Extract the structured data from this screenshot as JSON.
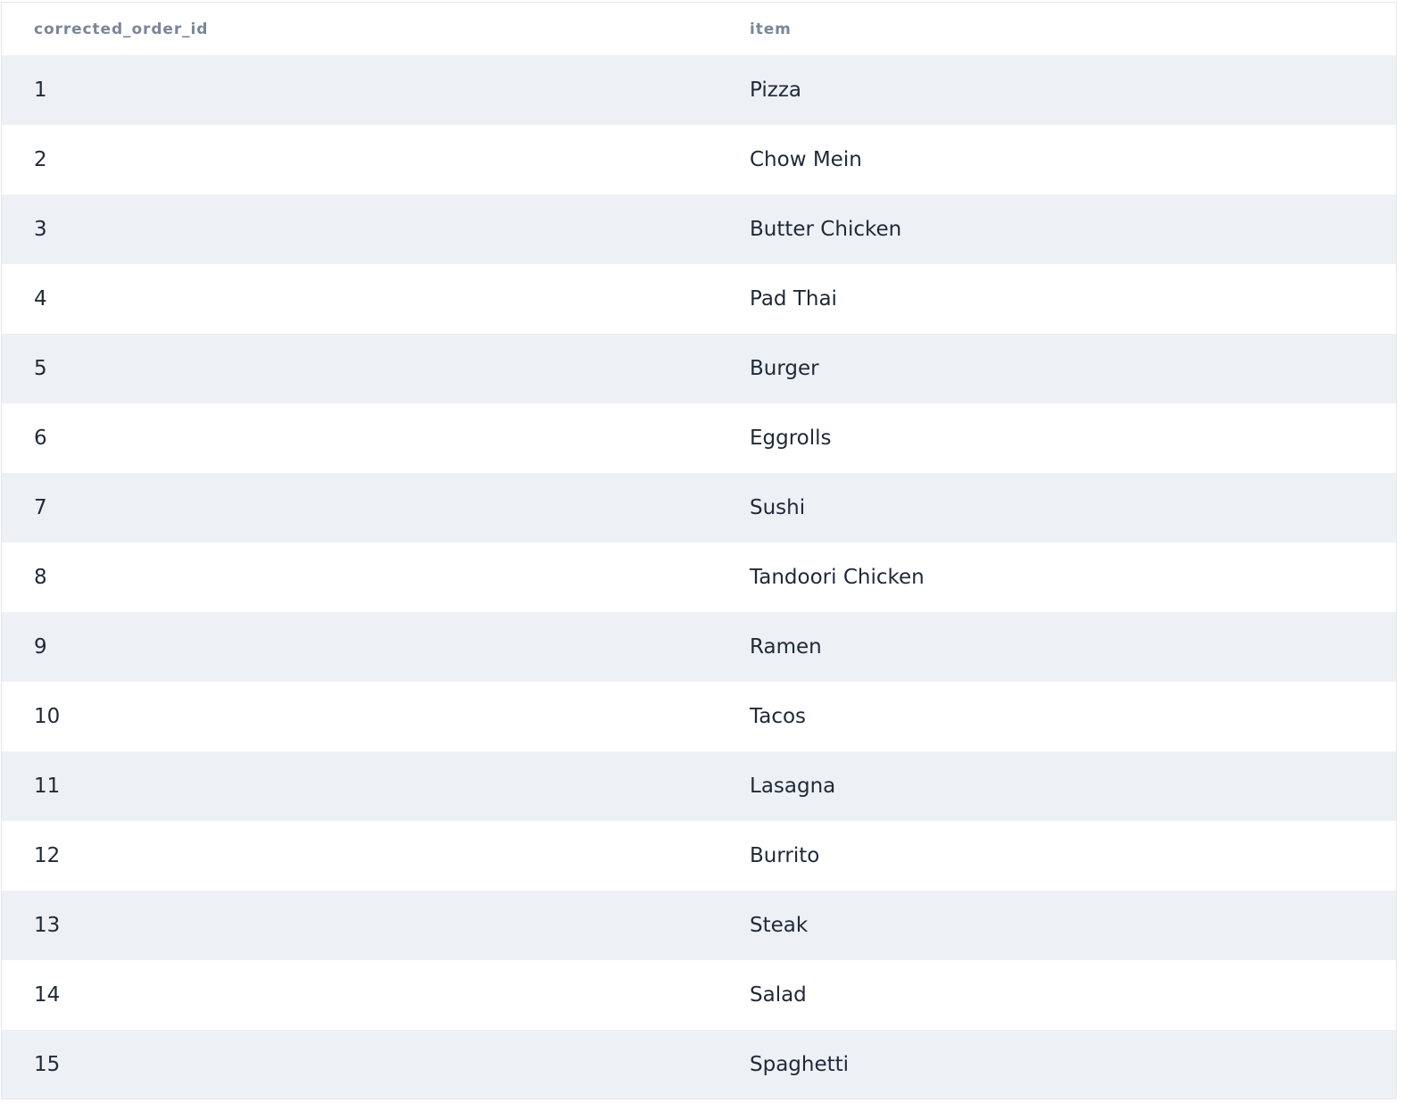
{
  "table": {
    "columns": [
      "corrected_order_id",
      "item"
    ],
    "rows": [
      {
        "id": "1",
        "item": "Pizza"
      },
      {
        "id": "2",
        "item": "Chow Mein"
      },
      {
        "id": "3",
        "item": "Butter Chicken"
      },
      {
        "id": "4",
        "item": "Pad Thai"
      },
      {
        "id": "5",
        "item": "Burger"
      },
      {
        "id": "6",
        "item": "Eggrolls"
      },
      {
        "id": "7",
        "item": "Sushi"
      },
      {
        "id": "8",
        "item": "Tandoori Chicken"
      },
      {
        "id": "9",
        "item": "Ramen"
      },
      {
        "id": "10",
        "item": "Tacos"
      },
      {
        "id": "11",
        "item": "Lasagna"
      },
      {
        "id": "12",
        "item": "Burrito"
      },
      {
        "id": "13",
        "item": "Steak"
      },
      {
        "id": "14",
        "item": "Salad"
      },
      {
        "id": "15",
        "item": "Spaghetti"
      }
    ]
  },
  "colors": {
    "header_text": "#7a8699",
    "row_stripe": "#edf0f5",
    "cell_text": "#1f2937"
  }
}
